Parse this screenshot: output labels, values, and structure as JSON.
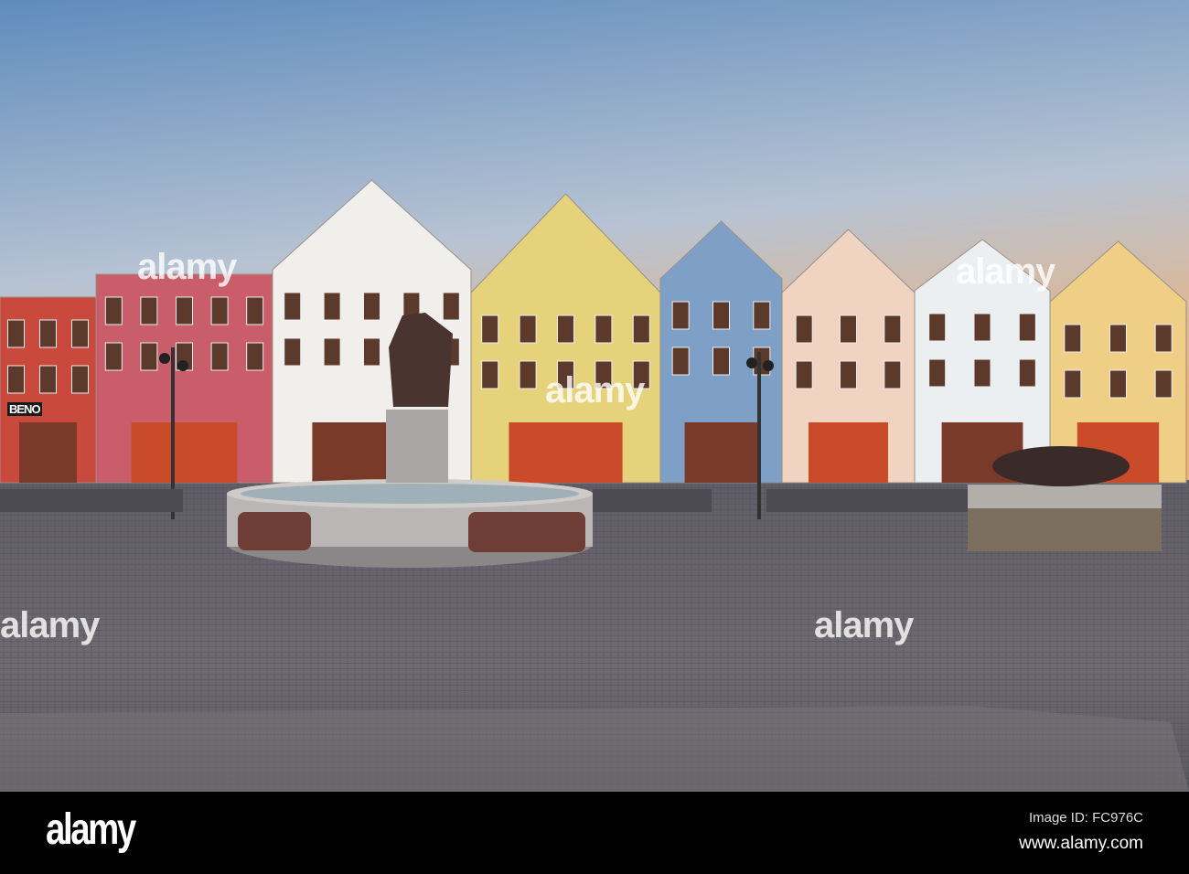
{
  "photo": {
    "subject": "Town square with colourful gabled houses and a fountain at dusk",
    "shop_sign": "BENO",
    "house_colors": [
      "#c94a3c",
      "#c95d6a",
      "#f1efec",
      "#e7d27c",
      "#7fa0c6",
      "#f0d3c0",
      "#eceff2",
      "#efcf86"
    ],
    "sky_colors": [
      "#6d93bf",
      "#b9c6d6",
      "#f2b57c"
    ],
    "pavement_color": "#6c6970"
  },
  "watermark": {
    "text": "alamy",
    "small_text": "a"
  },
  "footer": {
    "logo": "alamy",
    "image_id": "Image ID: FC976C",
    "website": "www.alamy.com"
  }
}
